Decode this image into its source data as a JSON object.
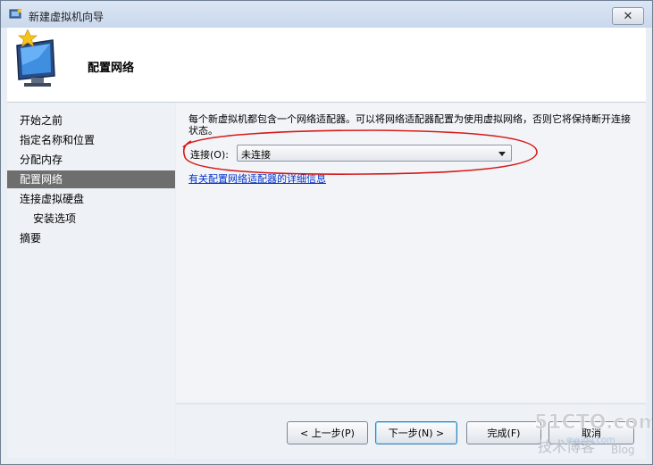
{
  "window": {
    "title": "新建虚拟机向导",
    "close_symbol": "✕"
  },
  "header": {
    "title": "配置网络"
  },
  "sidebar": {
    "items": [
      {
        "label": "开始之前",
        "active": false
      },
      {
        "label": "指定名称和位置",
        "active": false
      },
      {
        "label": "分配内存",
        "active": false
      },
      {
        "label": "配置网络",
        "active": true
      },
      {
        "label": "连接虚拟硬盘",
        "active": false
      },
      {
        "label": "安装选项",
        "active": false
      },
      {
        "label": "摘要",
        "active": false
      }
    ]
  },
  "main": {
    "description": "每个新虚拟机都包含一个网络适配器。可以将网络适配器配置为使用虚拟网络，否则它将保持断开连接状态。",
    "connection_label": "连接(O):",
    "connection_value": "未连接",
    "more_info_link": "有关配置网络适配器的详细信息"
  },
  "footer": {
    "prev_label": "< 上一步(P)",
    "next_label": "下一步(N) >",
    "finish_label": "完成(F)",
    "cancel_label": "取消"
  },
  "watermark": {
    "line1": "51CTO.com",
    "line2": "技术博客",
    "line3": "Blog",
    "small": "gyunv.com"
  },
  "colors": {
    "active_item": "#6e6e6e",
    "annotation": "#d61a1a",
    "link": "#0033cc"
  },
  "icons": {
    "title": "wizard-icon",
    "header": "new-vm-monitor-icon",
    "arrow": "chevron-down-icon"
  }
}
